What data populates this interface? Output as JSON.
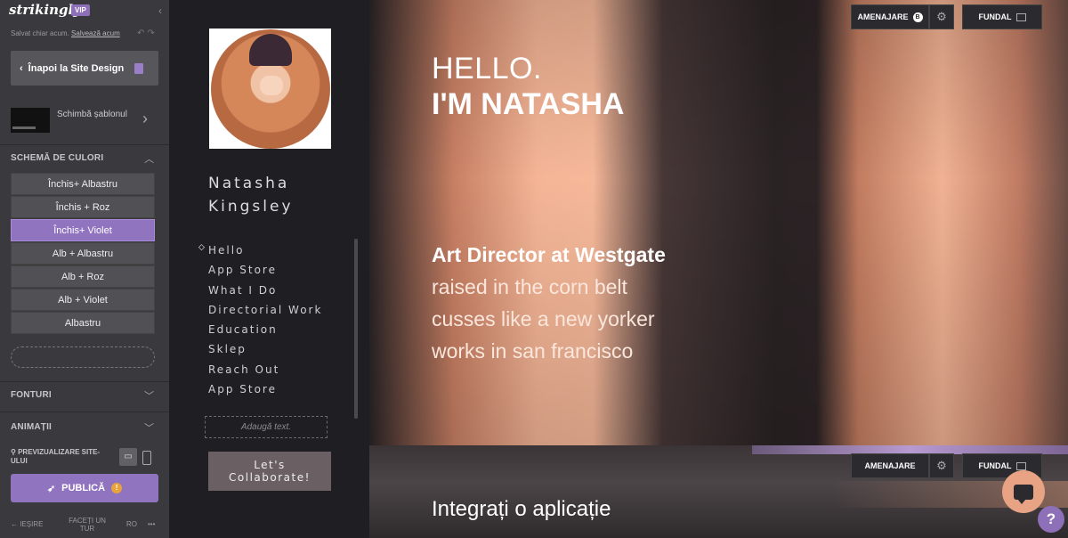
{
  "editor": {
    "logo": "strikingly",
    "vip_badge": "VIP",
    "saved_text": "Salvat chiar acum.",
    "save_link": "Salvează acum",
    "back_button": "Înapoi la Site Design",
    "template_label": "Schimbă șablonul",
    "color_scheme_title": "SCHEMĂ DE CULORI",
    "color_schemes": [
      "Închis+ Albastru",
      "Închis + Roz",
      "Închis+ Violet",
      "Alb + Albastru",
      "Alb + Roz",
      "Alb + Violet",
      "Albastru"
    ],
    "active_scheme_index": 2,
    "fonts_title": "FONTURI",
    "animations_title": "ANIMAȚII",
    "preview_label": "PREVIZUALIZARE SITE-ULUI",
    "publish_button": "PUBLICĂ",
    "footer": {
      "exit": "IEȘIRE",
      "tour": "FACEȚI UN TUR",
      "language": "RO",
      "more": "•••"
    }
  },
  "site": {
    "name_line1": "Natasha",
    "name_line2": "Kingsley",
    "nav": [
      "Hello",
      "App Store",
      "What I Do",
      "Directorial Work",
      "Education",
      "Sklep",
      "Reach Out",
      "App Store"
    ],
    "add_text": "Adaugă text.",
    "collab_line1": "Let's",
    "collab_line2": "Collaborate!",
    "hero": {
      "line1": "HELLO.",
      "line2": "I'M NATASHA",
      "sub_bold": "Art Director at Westgate",
      "sub_lines": [
        "raised in the corn belt",
        "cusses like a new yorker",
        "works in san francisco"
      ]
    },
    "controls": {
      "arrange": "AMENAJARE",
      "arrange_badge": "B",
      "background": "FUNDAL"
    },
    "section2_title": "Integrați o aplicație"
  },
  "colors": {
    "accent": "#9174bf",
    "sidebar_bg": "#3a3a3e",
    "nav_bg": "#1e1e23",
    "chat_bg": "#e8a385"
  },
  "icons": [
    "chevron-left-icon",
    "document-icon",
    "chevron-right-icon",
    "chevron-up-icon",
    "chevron-down-icon",
    "desktop-icon",
    "mobile-icon",
    "rocket-icon",
    "warning-icon",
    "gear-icon",
    "image-icon",
    "chat-icon",
    "help-icon"
  ]
}
